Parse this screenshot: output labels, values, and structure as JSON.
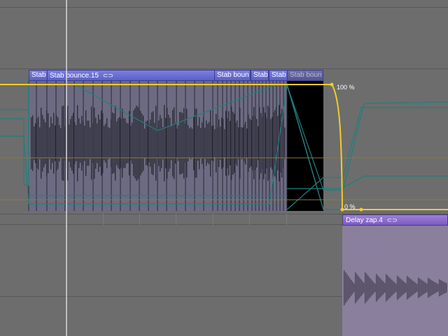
{
  "regions": {
    "stab_a": "Stab",
    "stab_bounce": "Stab bounce.15",
    "stab_boun": "Stab boun",
    "stab_b": "Stab",
    "stab_c": "Stab",
    "stab_boun_dim": "Stab boun"
  },
  "loop_icon": "loop-icon",
  "automation": {
    "top_label": "100 %",
    "bottom_label": "0 %"
  },
  "lower_region": {
    "name": "Delay zap.4"
  },
  "colors": {
    "automation": "#f2cc2c",
    "region_header": "#6a6dd4",
    "lower_region_header": "#8b6ccc",
    "teal_lines": "#1f7f7f"
  }
}
